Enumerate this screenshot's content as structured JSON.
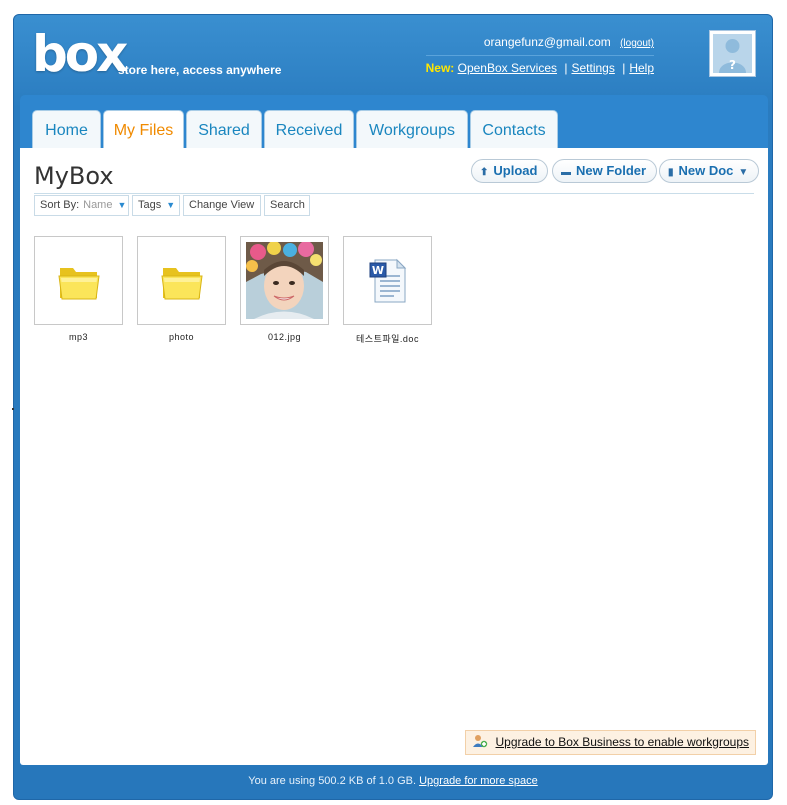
{
  "header": {
    "logo": "box",
    "tagline": "store here, access anywhere",
    "user_email": "orangefunz@gmail.com",
    "logout_label": "(logout)",
    "new_label": "New:",
    "links": [
      "OpenBox Services",
      "Settings",
      "Help"
    ]
  },
  "tabs": [
    {
      "label": "Home"
    },
    {
      "label": "My Files",
      "active": true
    },
    {
      "label": "Shared"
    },
    {
      "label": "Received"
    },
    {
      "label": "Workgroups"
    },
    {
      "label": "Contacts"
    }
  ],
  "main": {
    "title": "MyBox",
    "actions": {
      "upload": "Upload",
      "new_folder": "New Folder",
      "new_doc": "New Doc"
    },
    "toolbar": {
      "sort_by": "Sort By:",
      "sort_value": "Name",
      "tags": "Tags",
      "change_view": "Change View",
      "search": "Search"
    },
    "files": [
      {
        "name": "mp3",
        "icon": "folder-icon"
      },
      {
        "name": "photo",
        "icon": "folder-icon"
      },
      {
        "name": "012.jpg",
        "icon": "photo-thumbnail"
      },
      {
        "name": "테스트파일.doc",
        "icon": "word-doc-icon"
      }
    ],
    "upgrade_banner": "Upgrade to Box Business to enable workgroups"
  },
  "footer": {
    "usage_text": "You are using 500.2 KB of 1.0 GB.",
    "upgrade_link": "Upgrade for more space"
  },
  "colors": {
    "frame_blue": "#2a7cc0",
    "tab_text": "#1a86bf",
    "active_tab_text": "#f08a00",
    "new_label": "#ffe600"
  }
}
